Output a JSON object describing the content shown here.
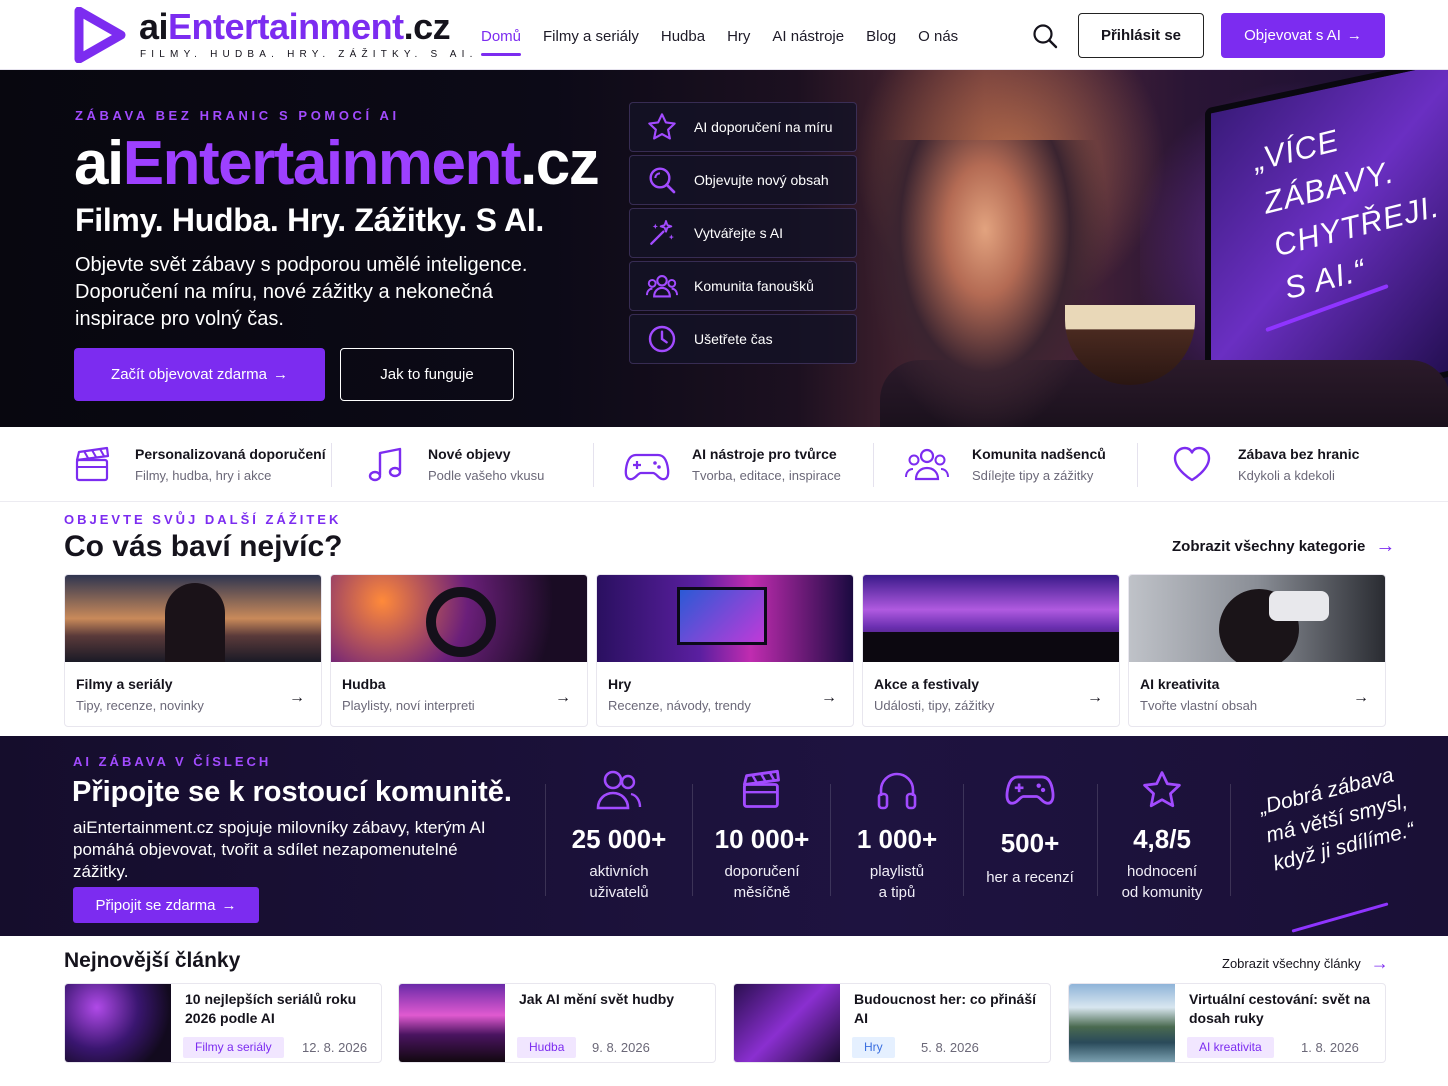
{
  "header": {
    "logo_prefix": "ai",
    "logo_brand": "Entertainment",
    "logo_suffix": ".cz",
    "tagline": "FILMY. HUDBA. HRY. ZÁŽITKY. S AI.",
    "nav": [
      "Domů",
      "Filmy a seriály",
      "Hudba",
      "Hry",
      "AI nástroje",
      "Blog",
      "O nás"
    ],
    "active_nav": "Domů",
    "login_label": "Přihlásit se",
    "explore_label": "Objevovat s AI"
  },
  "hero": {
    "eyebrow": "ZÁBAVA BEZ HRANIC S POMOCÍ AI",
    "title_prefix": "ai",
    "title_brand": "Entertainment",
    "title_suffix": ".cz",
    "subtitle": "Filmy. Hudba. Hry. Zážitky. S AI.",
    "description": "Objevte svět zábavy s podporou umělé inteligence. Doporučení na míru, nové zážitky a nekonečná inspirace pro volný čas.",
    "cta_primary": "Začít objevovat zdarma",
    "cta_secondary": "Jak to funguje",
    "features": [
      {
        "icon": "star-icon",
        "label": "AI doporučení na míru"
      },
      {
        "icon": "search-icon",
        "label": "Objevujte nový obsah"
      },
      {
        "icon": "sparkles-icon",
        "label": "Vytvářejte s AI"
      },
      {
        "icon": "community-icon",
        "label": "Komunita fanoušků"
      },
      {
        "icon": "clock-icon",
        "label": "Ušetřete čas"
      }
    ],
    "quote": "„VÍCE\nZÁBAVY.\nCHYTŘEJI.\nS AI.“"
  },
  "benefits": [
    {
      "icon": "clapperboard-icon",
      "title": "Personalizovaná doporučení",
      "subtitle": "Filmy, hudba, hry i akce"
    },
    {
      "icon": "music-note-icon",
      "title": "Nové objevy",
      "subtitle": "Podle vašeho vkusu"
    },
    {
      "icon": "gamepad-icon",
      "title": "AI nástroje pro tvůrce",
      "subtitle": "Tvorba, editace, inspirace"
    },
    {
      "icon": "community-icon",
      "title": "Komunita nadšenců",
      "subtitle": "Sdílejte tipy a zážitky"
    },
    {
      "icon": "heart-icon",
      "title": "Zábava bez hranic",
      "subtitle": "Kdykoli a kdekoli"
    }
  ],
  "categories_section": {
    "eyebrow": "OBJEVTE SVŮJ DALŠÍ ZÁŽITEK",
    "title": "Co vás baví nejvíc?",
    "link": "Zobrazit všechny kategorie",
    "items": [
      {
        "name": "Filmy a seriály",
        "subtitle": "Tipy, recenze, novinky"
      },
      {
        "name": "Hudba",
        "subtitle": "Playlisty, noví interpreti"
      },
      {
        "name": "Hry",
        "subtitle": "Recenze, návody, trendy"
      },
      {
        "name": "Akce a festivaly",
        "subtitle": "Události, tipy, zážitky"
      },
      {
        "name": "AI kreativita",
        "subtitle": "Tvořte vlastní obsah"
      }
    ]
  },
  "stats_section": {
    "eyebrow": "AI ZÁBAVA V ČÍSLECH",
    "title": "Připojte se k rostoucí komunitě.",
    "description": "aiEntertainment.cz spojuje milovníky zábavy, kterým AI pomáhá objevovat, tvořit a sdílet nezapomenutelné zážitky.",
    "cta": "Připojit se zdarma",
    "stats": [
      {
        "icon": "users-icon",
        "value": "25 000+",
        "label1": "aktivních",
        "label2": "uživatelů"
      },
      {
        "icon": "clapperboard-icon",
        "value": "10 000+",
        "label1": "doporučení",
        "label2": "měsíčně"
      },
      {
        "icon": "headphones-icon",
        "value": "1 000+",
        "label1": "playlistů",
        "label2": "a tipů"
      },
      {
        "icon": "gamepad-icon",
        "value": "500+",
        "label1": "her a recenzí",
        "label2": ""
      },
      {
        "icon": "star-icon",
        "value": "4,8/5",
        "label1": "hodnocení",
        "label2": "od komunity"
      }
    ],
    "quote": "„Dobrá zábava\nmá větší smysl,\nkdyž ji sdílíme.“"
  },
  "articles_section": {
    "title": "Nejnovější články",
    "link": "Zobrazit všechny články",
    "items": [
      {
        "title": "10 nejlepších seriálů roku 2026 podle AI",
        "tag": "Filmy a seriály",
        "date": "12. 8. 2026"
      },
      {
        "title": "Jak AI mění svět hudby",
        "tag": "Hudba",
        "date": "9. 8. 2026"
      },
      {
        "title": "Budoucnost her: co přináší AI",
        "tag": "Hry",
        "date": "5. 8. 2026"
      },
      {
        "title": "Virtuální cestování: svět na dosah ruky",
        "tag": "AI kreativita",
        "date": "1. 8. 2026"
      }
    ]
  },
  "colors": {
    "accent": "#7c2cf0",
    "accent_light": "#9d40ff",
    "dark": "#0d0b18",
    "stats_bg": "#1e1340"
  }
}
